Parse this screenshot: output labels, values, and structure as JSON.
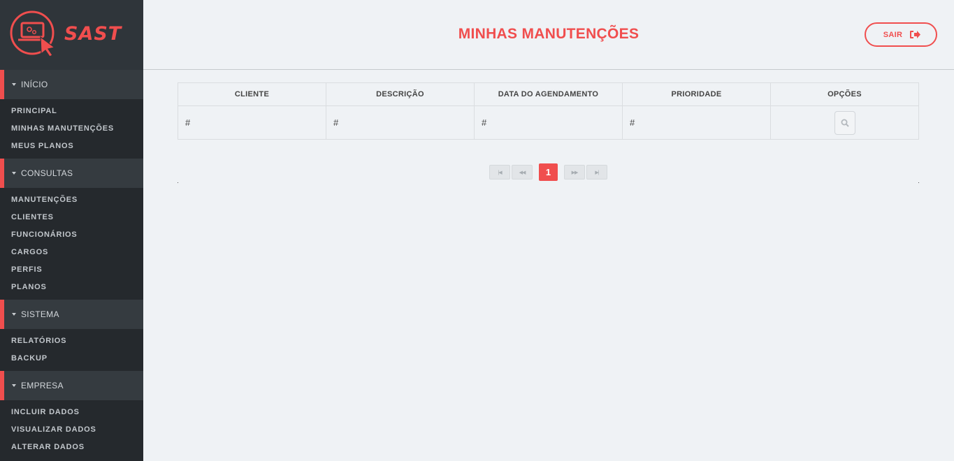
{
  "brand": {
    "name": "SAST",
    "accent": "#f04e4e"
  },
  "sidebar": {
    "sections": [
      {
        "title": "INÍCIO",
        "items": [
          "PRINCIPAL",
          "MINHAS MANUTENÇÕES",
          "MEUS PLANOS"
        ]
      },
      {
        "title": "CONSULTAS",
        "items": [
          "MANUTENÇÕES",
          "CLIENTES",
          "FUNCIONÁRIOS",
          "CARGOS",
          "PERFIS",
          "PLANOS"
        ]
      },
      {
        "title": "SISTEMA",
        "items": [
          "RELATÓRIOS",
          "BACKUP"
        ]
      },
      {
        "title": "EMPRESA",
        "items": [
          "INCLUIR DADOS",
          "VISUALIZAR DADOS",
          "ALTERAR DADOS"
        ]
      }
    ]
  },
  "header": {
    "title": "MINHAS MANUTENÇÕES",
    "logout_label": "SAIR",
    "logout_icon": "sign-out-icon"
  },
  "table": {
    "columns": [
      "CLIENTE",
      "DESCRIÇÃO",
      "DATA DO AGENDAMENTO",
      "PRIORIDADE",
      "OPÇÕES"
    ],
    "rows": [
      {
        "cliente": "#",
        "descricao": "#",
        "data": "#",
        "prioridade": "#",
        "opcoes_icon": "search-icon"
      }
    ]
  },
  "pagination": {
    "first": "|◀",
    "prev": "◀◀",
    "current": "1",
    "next": "▶▶",
    "last": "▶|"
  }
}
